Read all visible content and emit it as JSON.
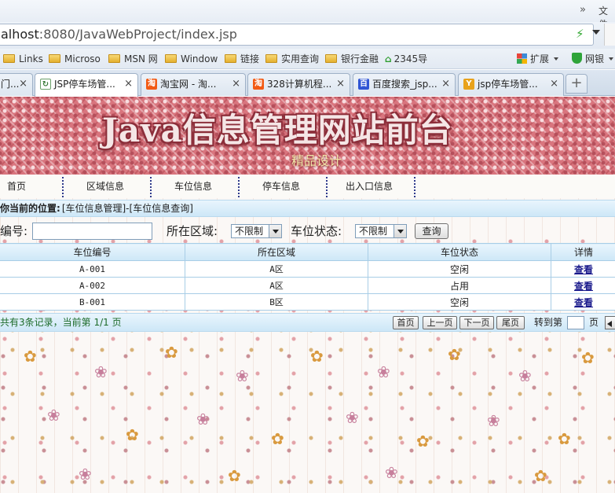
{
  "browser": {
    "titlebar": {
      "chevron": "»",
      "menu": "文件"
    },
    "address": {
      "host": "alhost",
      "rest": ":8080/JavaWebProject/index.jsp"
    },
    "bookmarks": [
      {
        "label": "Links"
      },
      {
        "label": "Microso"
      },
      {
        "label": "MSN 网"
      },
      {
        "label": "Window"
      },
      {
        "label": "链接"
      },
      {
        "label": "实用查询"
      },
      {
        "label": "银行金融"
      }
    ],
    "bookmark_2345": "2345导",
    "extension_label": "扩展",
    "netbank_label": "网银",
    "tabs": [
      {
        "label": "门...",
        "icon": ""
      },
      {
        "label": "JSP停车场管...",
        "icon": "page"
      },
      {
        "label": "淘宝网 - 淘...",
        "icon": "淘"
      },
      {
        "label": "328计算机程...",
        "icon": "淘"
      },
      {
        "label": "百度搜索_jsp...",
        "icon": "百"
      },
      {
        "label": "jsp停车场管...",
        "icon": "Y"
      }
    ],
    "tab_close_glyph": "×",
    "new_tab_glyph": "+"
  },
  "site": {
    "banner_title": "Java信息管理网站前台",
    "banner_subtitle": "精品设计",
    "nav": [
      "首页",
      "区域信息",
      "车位信息",
      "停车信息",
      "出入口信息"
    ],
    "location_label": "你当前的位置:",
    "location_path": "[车位信息管理]-[车位信息查询]"
  },
  "search": {
    "code_label": "编号:",
    "code_value": "",
    "area_label": "所在区域:",
    "area_selected": "不限制",
    "state_label": "车位状态:",
    "state_selected": "不限制",
    "query_button": "查询"
  },
  "table": {
    "headers": [
      "车位编号",
      "所在区域",
      "车位状态",
      "详情"
    ],
    "rows": [
      {
        "code": "A-001",
        "area": "A区",
        "state": "空闲",
        "link": "查看"
      },
      {
        "code": "A-002",
        "area": "A区",
        "state": "占用",
        "link": "查看"
      },
      {
        "code": "B-001",
        "area": "B区",
        "state": "空闲",
        "link": "查看"
      }
    ]
  },
  "pager": {
    "summary": "共有3条记录，当前第 1/1 页",
    "first": "首页",
    "prev": "上一页",
    "next": "下一页",
    "last": "尾页",
    "goto_label": "转到第",
    "page_suffix": "页"
  },
  "colors": {
    "banner": "#d9757e",
    "title_stroke": "#8c2e3a",
    "table_border": "#a8cde6",
    "header_band": "#cde7f7",
    "link": "#1a1a8c"
  }
}
